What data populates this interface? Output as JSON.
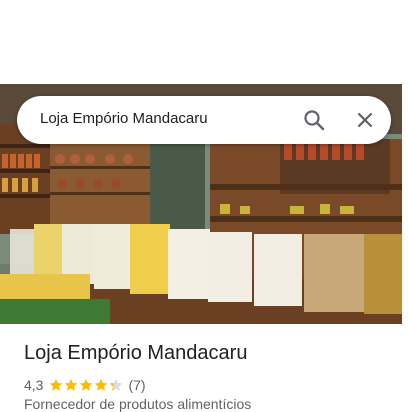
{
  "search": {
    "query": "Loja Empório Mandacaru",
    "search_icon": "search-icon",
    "close_icon": "close-icon"
  },
  "place": {
    "name": "Loja Empório Mandacaru",
    "rating_text": "4,3",
    "rating_value": 4.3,
    "rating_max": 5,
    "review_count": "(7)",
    "category": "Fornecedor de produtos alimentícios"
  },
  "colors": {
    "star": "#fbbc04",
    "star_empty": "#dadce0",
    "text_primary": "#202124",
    "text_secondary": "#5f6368"
  }
}
